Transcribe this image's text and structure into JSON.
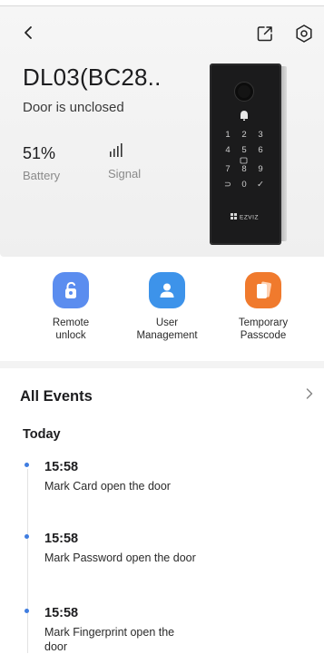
{
  "device": {
    "name": "DL03(BC28..",
    "status": "Door is unclosed",
    "battery_value": "51%",
    "battery_label": "Battery",
    "signal_label": "Signal",
    "keypad": [
      "1",
      "2",
      "3",
      "4",
      "5",
      "6",
      "7",
      "8",
      "9",
      "⊃",
      "0",
      "✓"
    ],
    "brand": "EZVIZ"
  },
  "actions": [
    {
      "label_line1": "Remote",
      "label_line2": "unlock",
      "color": "#5b8def"
    },
    {
      "label_line1": "User",
      "label_line2": "Management",
      "color": "#3d93ea"
    },
    {
      "label_line1": "Temporary",
      "label_line2": "Passcode",
      "color": "#f07a2d"
    }
  ],
  "events": {
    "title": "All Events",
    "group": "Today",
    "items": [
      {
        "time": "15:58",
        "desc": "Mark Card open the door"
      },
      {
        "time": "15:58",
        "desc": "Mark Password open the door"
      },
      {
        "time": "15:58",
        "desc": "Mark Fingerprint open the door"
      }
    ]
  },
  "colors": {
    "accent": "#3f7de0"
  }
}
